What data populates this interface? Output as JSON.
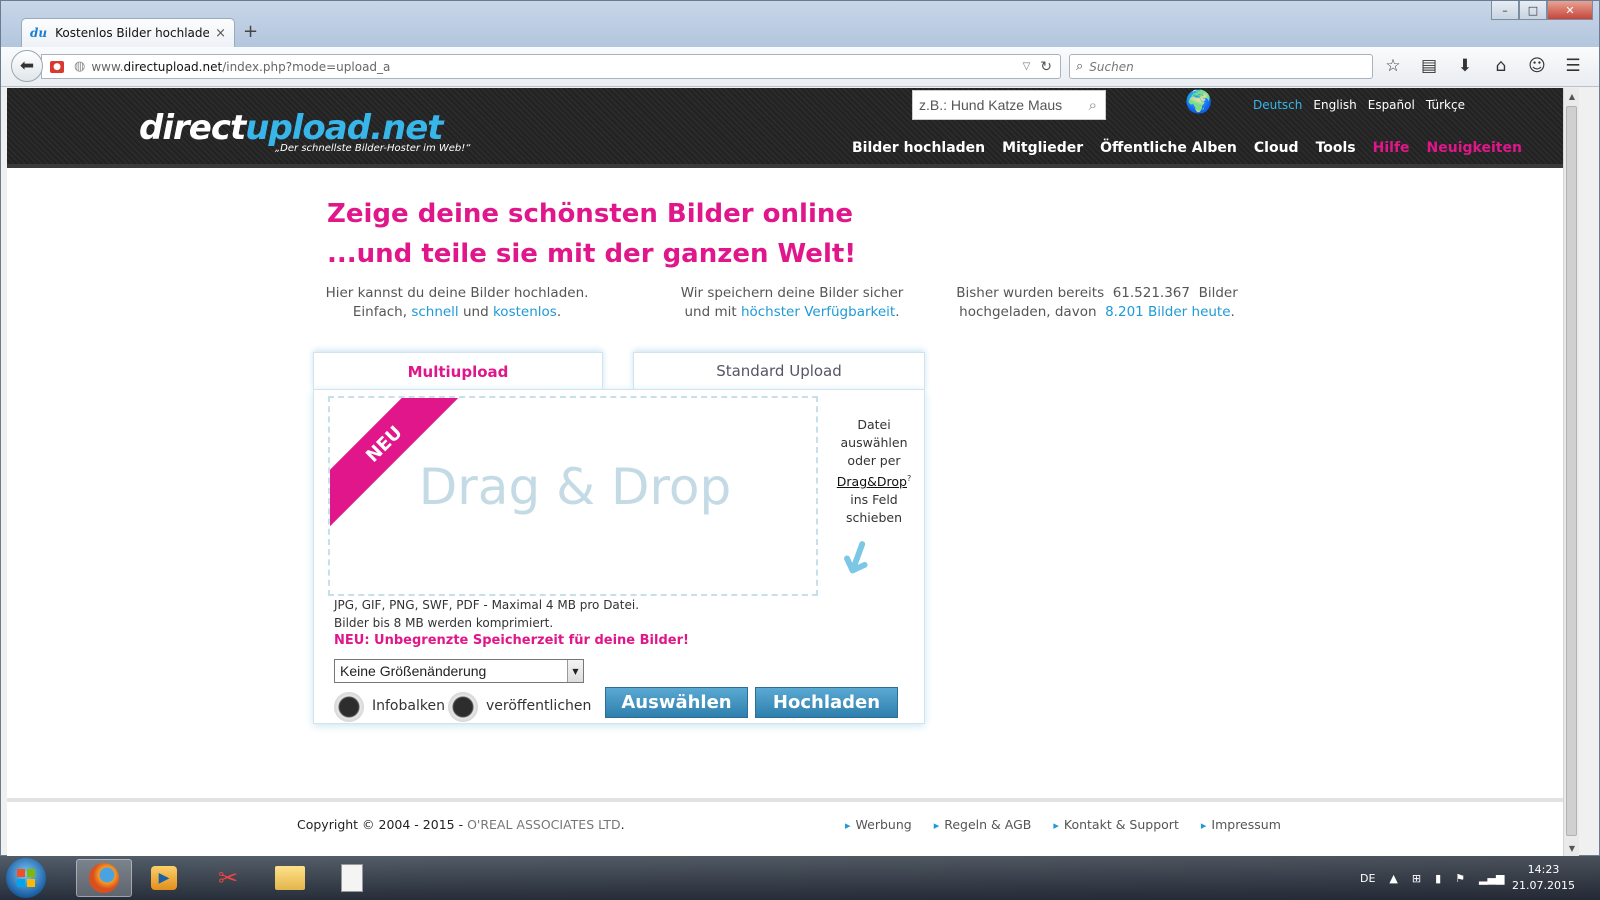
{
  "browser": {
    "tab_favicon": "du",
    "tab_title": "Kostenlos Bilder hochladen...",
    "tab_close": "×",
    "new_tab": "+",
    "url_prefix": "www.",
    "url_domain": "directupload.net",
    "url_path": "/index.php?mode=upload_a",
    "search_placeholder": "Suchen",
    "window_buttons": [
      "–",
      "□",
      "✕"
    ]
  },
  "site": {
    "logo_part1": "direct",
    "logo_part2": "upload.net",
    "tagline": "„Der schnellste Bilder-Hoster im Web!“",
    "search_placeholder": "z.B.: Hund Katze Maus",
    "languages": [
      "Deutsch",
      "English",
      "Español",
      "Türkçe"
    ],
    "nav": [
      "Bilder hochladen",
      "Mitglieder",
      "Öffentliche Alben",
      "Cloud",
      "Tools",
      "Hilfe",
      "Neuigkeiten"
    ]
  },
  "hero": {
    "line1": "Zeige deine schönsten Bilder online",
    "line2": "...und teile sie mit der ganzen Welt!"
  },
  "info": {
    "col1_line1": "Hier kannst du deine Bilder hochladen.",
    "col1_pre": "Einfach, ",
    "col1_link1": "schnell",
    "col1_mid": " und ",
    "col1_link2": "kostenlos",
    "col1_end": ".",
    "col2_line1": "Wir speichern deine Bilder sicher",
    "col2_pre": "und mit ",
    "col2_link": "höchster Verfügbarkeit",
    "col2_end": ".",
    "col3_line1": "Bisher wurden bereits  61.521.367  Bilder",
    "col3_pre": "hochgeladen, davon  ",
    "col3_link": "8.201 Bilder heute",
    "col3_end": "."
  },
  "upload": {
    "tab_multi": "Multiupload",
    "tab_standard": "Standard Upload",
    "ribbon": "NEU",
    "dropzone": "Drag & Drop",
    "side_note_1": "Datei",
    "side_note_2": "auswählen",
    "side_note_3": "oder per",
    "side_note_link": "Drag&Drop",
    "side_note_sup": "?",
    "side_note_4": "ins Feld",
    "side_note_5": "schieben",
    "formats_line1": "JPG, GIF, PNG, SWF, PDF - Maximal 4 MB pro Datei.",
    "formats_line2": "Bilder bis 8 MB werden komprimiert.",
    "neu_line": "NEU: Unbegrenzte Speicherzeit für deine Bilder!",
    "resize_selected": "Keine Größenänderung",
    "toggle1_label": "Infobalken",
    "toggle2_label": "veröffentlichen",
    "btn_select": "Auswählen",
    "btn_upload": "Hochladen"
  },
  "footer": {
    "copyright": "Copyright © 2004 - 2015 - ",
    "company": "O'REAL ASSOCIATES LTD",
    "copyright_end": ".",
    "links": [
      "Werbung",
      "Regeln & AGB",
      "Kontakt & Support",
      "Impressum"
    ]
  },
  "taskbar": {
    "language": "DE",
    "time": "14:23",
    "date": "21.07.2015"
  },
  "colors": {
    "brand_pink": "#e0168a",
    "link_blue": "#1e9ad6",
    "button_blue": "#3c8fc0"
  }
}
